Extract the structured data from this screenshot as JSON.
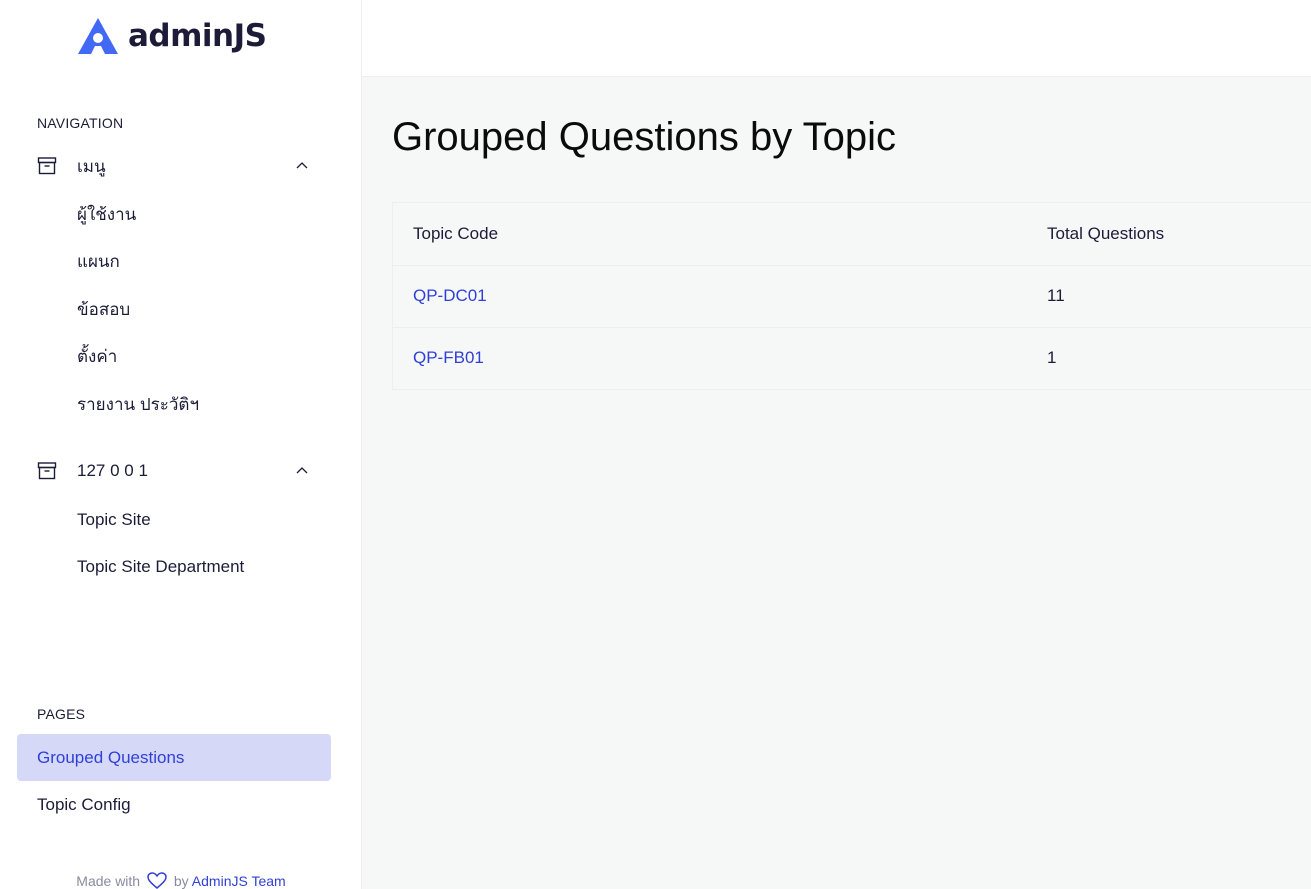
{
  "brand": {
    "logo_text": "adminJS"
  },
  "sidebar": {
    "navigation_label": "NAVIGATION",
    "groups": [
      {
        "title": "เมนู",
        "icon": "archive-box-icon",
        "items": [
          "ผู้ใช้งาน",
          "แผนก",
          "ข้อสอบ",
          "ตั้งค่า",
          "รายงาน ประวัติฯ"
        ]
      },
      {
        "title": "127 0 0 1",
        "icon": "archive-box-icon",
        "items": [
          "Topic Site",
          "Topic Site Department"
        ]
      }
    ],
    "pages_label": "PAGES",
    "pages": [
      {
        "label": "Grouped Questions",
        "active": true
      },
      {
        "label": "Topic Config",
        "active": false
      }
    ]
  },
  "footer": {
    "made_with": "Made with",
    "by": "by",
    "team": "AdminJS Team"
  },
  "main": {
    "title": "Grouped Questions by Topic",
    "table": {
      "headers": [
        "Topic Code",
        "Total Questions"
      ],
      "rows": [
        {
          "code": "QP-DC01",
          "total": "11"
        },
        {
          "code": "QP-FB01",
          "total": "1"
        }
      ]
    }
  },
  "colors": {
    "accent": "#3040d6",
    "active_bg": "#d6d8f8",
    "logo_blue": "#4268f6",
    "main_bg": "#f6f7f7"
  }
}
